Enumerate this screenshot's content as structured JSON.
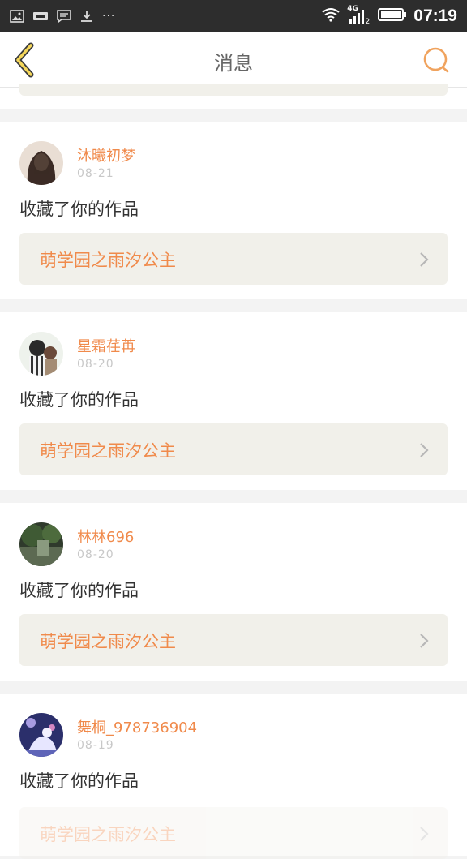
{
  "status_bar": {
    "time": "07:19",
    "network": "4G",
    "sim_slot": "2",
    "icons": [
      "image-icon",
      "sale-tag-icon",
      "message-icon",
      "download-icon",
      "more-dots-icon",
      "wifi-icon",
      "signal-icon",
      "battery-icon"
    ],
    "more": "···"
  },
  "nav": {
    "title": "消息",
    "back_icon": "chevron-left-icon",
    "search_icon": "search-icon",
    "accent": "#f0a35e"
  },
  "messages": [
    {
      "user": "沐曦初梦",
      "date": "08-21",
      "action": "收藏了你的作品",
      "work": "萌学园之雨汐公主",
      "avatar": "user-avatar"
    },
    {
      "user": "星霜荏苒",
      "date": "08-20",
      "action": "收藏了你的作品",
      "work": "萌学园之雨汐公主",
      "avatar": "user-avatar"
    },
    {
      "user": "林林696",
      "date": "08-20",
      "action": "收藏了你的作品",
      "work": "萌学园之雨汐公主",
      "avatar": "user-avatar"
    },
    {
      "user": "舞桐_978736904",
      "date": "08-19",
      "action": "收藏了你的作品",
      "work": "萌学园之雨汐公主",
      "avatar": "user-avatar"
    }
  ],
  "colors": {
    "accent_text": "#f08a4b",
    "link_bg": "#f1f0ea",
    "page_bg": "#f3f3f3",
    "status_bg": "#2d2d2d"
  }
}
